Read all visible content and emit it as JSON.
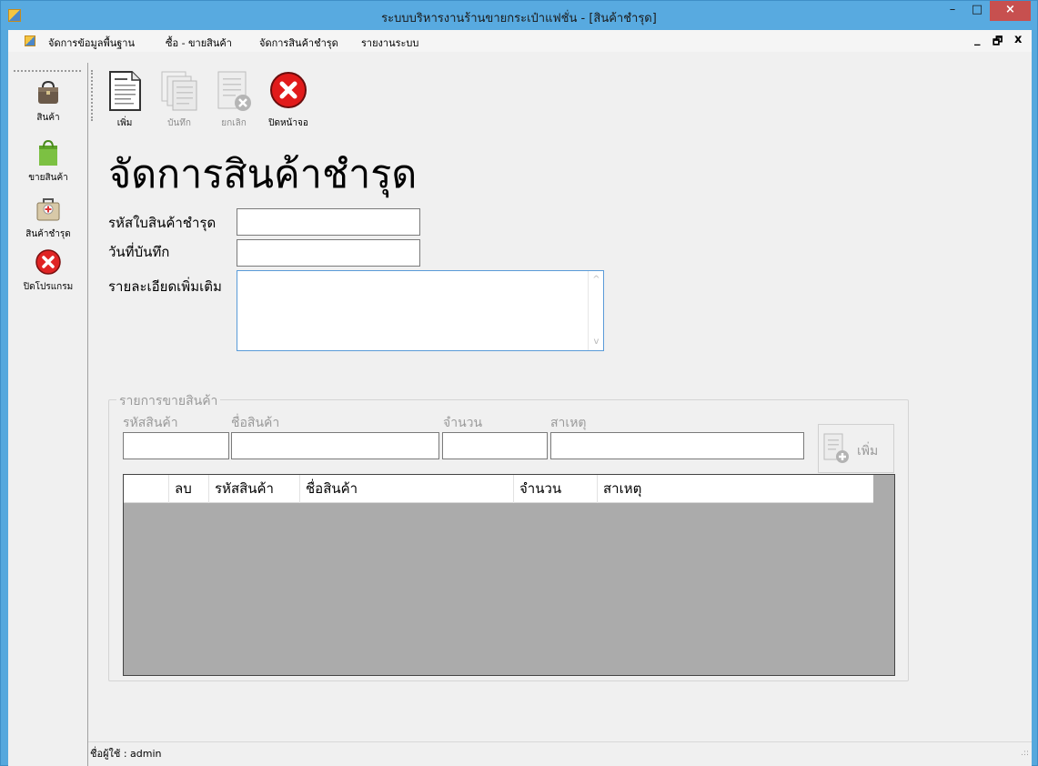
{
  "window": {
    "title": "ระบบบริหารงานร้านขายกระเป๋าแฟชั่น - [สินค้าชำรุด]",
    "minimize": "–",
    "maximize": "□",
    "close": "×"
  },
  "menu": {
    "items": [
      "จัดการข้อมูลพื้นฐาน",
      "ซื้อ - ขายสินค้า",
      "จัดการสินค้าชำรุด",
      "รายงานระบบ"
    ],
    "mdi_min": "_",
    "mdi_restore": "🗗",
    "mdi_close": "x"
  },
  "sidebar": {
    "items": [
      {
        "label": "สินค้า",
        "icon": "bag-icon"
      },
      {
        "label": "ขายสินค้า",
        "icon": "shopping-bag-icon"
      },
      {
        "label": "สินค้าชำรุด",
        "icon": "first-aid-bag-icon"
      },
      {
        "label": "ปิดโปรแกรม",
        "icon": "close-circle-icon"
      }
    ]
  },
  "toolbar": {
    "add_label": "เพิ่ม",
    "save_label": "บันทึก",
    "cancel_label": "ยกเลิก",
    "close_label": "ปิดหน้าจอ"
  },
  "form": {
    "title": "จัดการสินค้าชำรุด",
    "doc_id_label": "รหัสใบสินค้าชำรุด",
    "doc_id_value": "",
    "date_label": "วันที่บันทึก",
    "date_value": "",
    "detail_label": "รายละเอียดเพิ่มเติม",
    "detail_value": ""
  },
  "group": {
    "legend": "รายการขายสินค้า",
    "product_code_label": "รหัสสินค้า",
    "product_name_label": "ชื่อสินค้า",
    "qty_label": "จำนวน",
    "reason_label": "สาเหตุ",
    "add_button": "เพิ่ม"
  },
  "grid": {
    "columns": [
      "",
      "ลบ",
      "รหัสสินค้า",
      "ชื่อสินค้า",
      "จำนวน",
      "สาเหตุ"
    ],
    "rows": []
  },
  "status": {
    "user_text": "ชื่อผู้ใช้ :  admin"
  },
  "colors": {
    "titlebar": "#58aae0",
    "close_button": "#c7504f",
    "grid_background": "#ababab"
  }
}
